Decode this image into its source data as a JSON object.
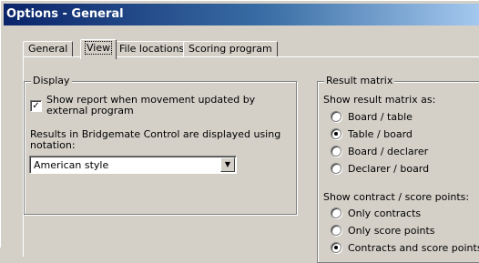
{
  "window": {
    "title": "Options - General"
  },
  "tabs": [
    {
      "label": "General"
    },
    {
      "label": "View"
    },
    {
      "label": "File locations"
    },
    {
      "label": "Scoring program"
    }
  ],
  "display": {
    "title": "Display",
    "show_report_checked": true,
    "show_report_label_line1": "Show report when movement updated by",
    "show_report_label_line2": "external program",
    "notation_label_line1": "Results in Bridgemate Control are displayed using",
    "notation_label_line2": "notation:",
    "notation_value": "American style"
  },
  "result_matrix": {
    "title": "Result matrix",
    "show_as_label": "Show result matrix as:",
    "options": [
      {
        "label": "Board / table",
        "selected": false
      },
      {
        "label": "Table / board",
        "selected": true
      },
      {
        "label": "Board / declarer",
        "selected": false
      },
      {
        "label": "Declarer / board",
        "selected": false
      }
    ],
    "contract_label": "Show contract / score points:",
    "contract_options": [
      {
        "label": "Only contracts",
        "selected": false
      },
      {
        "label": "Only score points",
        "selected": false
      },
      {
        "label": "Contracts and score points",
        "selected": true
      }
    ]
  }
}
